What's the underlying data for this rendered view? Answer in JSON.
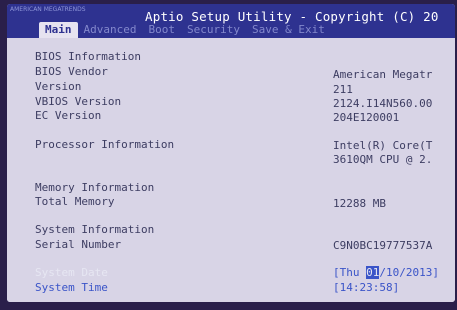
{
  "window": {
    "logo_text": "AMERICAN MEGATRENDS",
    "title": "Aptio Setup Utility - Copyright (C) 20"
  },
  "tabs": [
    {
      "label": "Main"
    },
    {
      "label": "Advanced"
    },
    {
      "label": "Boot"
    },
    {
      "label": "Security"
    },
    {
      "label": "Save & Exit"
    }
  ],
  "main": {
    "bios_header": "BIOS Information",
    "bios_vendor_label": "BIOS Vendor",
    "bios_vendor_value": "American Megatr",
    "version_label": "Version",
    "version_value": "211",
    "vbios_label": "VBIOS Version",
    "vbios_value": "2124.I14N560.00",
    "ec_label": "EC Version",
    "ec_value": "204E120001",
    "processor_label": "Processor Information",
    "processor_value_line1": "Intel(R) Core(T",
    "processor_value_line2": "3610QM CPU @ 2.",
    "memory_header": "Memory Information",
    "total_memory_label": "Total Memory",
    "total_memory_value": "12288 MB",
    "system_header": "System Information",
    "serial_label": "Serial Number",
    "serial_value": "C9N0BC19777537A",
    "date_label": "System Date",
    "date_prefix": "[Thu ",
    "date_cursor": "01",
    "date_suffix": "/10/2013]",
    "time_label": "System Time",
    "time_value": "[14:23:58]"
  },
  "colors": {
    "title_bar": "#2e3290",
    "body_bg": "#d8d4e6",
    "highlight_blue": "#3a54c8"
  }
}
